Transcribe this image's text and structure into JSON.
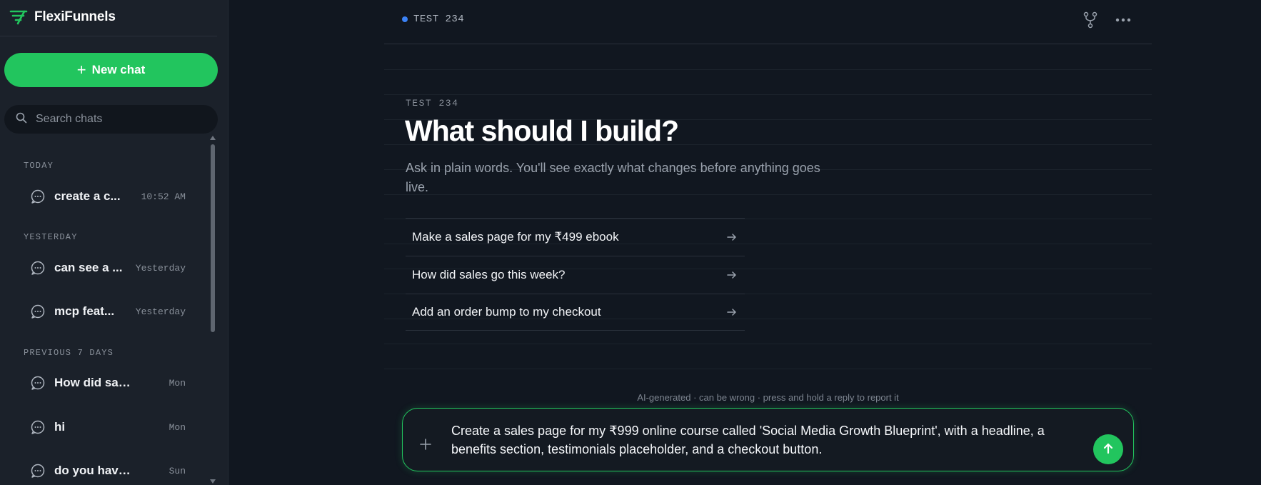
{
  "app": {
    "name": "FlexiFunnels",
    "accent": "#22c55e"
  },
  "sidebar": {
    "new_chat_label": "New chat",
    "search_placeholder": "Search chats",
    "sections": [
      {
        "label": "TODAY",
        "items": [
          {
            "title": "create a c...",
            "time": "10:52 AM"
          }
        ]
      },
      {
        "label": "YESTERDAY",
        "items": [
          {
            "title": "can see a ...",
            "time": "Yesterday"
          },
          {
            "title": "mcp feat...",
            "time": "Yesterday"
          }
        ]
      },
      {
        "label": "PREVIOUS 7 DAYS",
        "items": [
          {
            "title": "How did sales g...",
            "time": "Mon"
          },
          {
            "title": "hi",
            "time": "Mon"
          },
          {
            "title": "do you have fle...",
            "time": "Sun"
          }
        ]
      }
    ]
  },
  "header": {
    "project_name": "TEST 234",
    "status_color": "#3b82f6"
  },
  "main": {
    "eyebrow": "TEST 234",
    "headline": "What should I build?",
    "subtext": "Ask in plain words. You'll see exactly what changes before anything goes live.",
    "suggestions": [
      "Make a sales page for my ₹499 ebook",
      "How did sales go this week?",
      "Add an order bump to my checkout"
    ],
    "disclaimer": "AI-generated · can be wrong · press and hold a reply to report it"
  },
  "composer": {
    "value": "Create a sales page for my ₹999 online course called 'Social Media Growth Blueprint', with a headline, a benefits section, testimonials placeholder, and a checkout button."
  },
  "icons": {
    "brand": "funnel-logo-icon",
    "new_chat": "plus-icon",
    "search": "search-icon",
    "chat": "chat-bubble-icon",
    "branch": "branch-icon",
    "more": "more-horizontal-icon",
    "suggestion_arrow": "arrow-right-icon",
    "attach": "plus-icon",
    "send": "arrow-up-icon"
  }
}
